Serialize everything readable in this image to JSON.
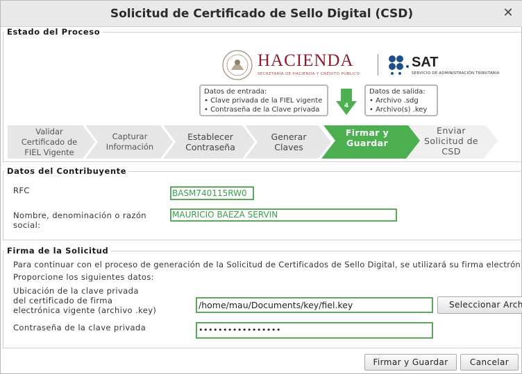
{
  "window": {
    "title": "Solicitud de Certificado de Sello Digital (CSD)"
  },
  "estado": {
    "legend": "Estado del Proceso",
    "logos": {
      "hacienda": "HACIENDA",
      "hacienda_sub": "SECRETARÍA DE HACIENDA Y CRÉDITO PÚBLICO",
      "sat": "SAT",
      "sat_sub": "SERVICIO DE ADMINISTRACIÓN TRIBUTARIA"
    },
    "entrada": {
      "title": "Datos de entrada:",
      "items": [
        "• Clave privada de la FIEL vigente",
        "• Contraseña de la Clave privada"
      ]
    },
    "salida": {
      "title": "Datos de salida:",
      "items": [
        "• Archivo .sdg",
        "• Archivo(s) .key"
      ]
    },
    "current_step_number": "4",
    "steps": [
      {
        "label": "Validar Certificado de FIEL Vigente"
      },
      {
        "label": "Capturar Información"
      },
      {
        "label": "Establecer Contraseña"
      },
      {
        "label": "Generar Claves"
      },
      {
        "label": "Firmar y Guardar"
      },
      {
        "label": "Enviar Solicitud de CSD"
      }
    ]
  },
  "contribuyente": {
    "legend": "Datos del Contribuyente",
    "rfc_label": "RFC",
    "rfc_value": "BASM740115RW0",
    "nombre_label_1": "Nombre, denominación o razón",
    "nombre_label_2": "social:",
    "nombre_value": "MAURICIO BAEZA SERVIN"
  },
  "firma": {
    "legend": "Firma de la Solicitud",
    "intro": "Para continuar con el proceso de generación de la Solicitud de Certificados de Sello Digital, se utilizará su firma electrónica vige",
    "proporcione": "Proporcione los siguientes datos:",
    "ubicacion_label": [
      "Ubicación de la clave privada",
      "del certificado de firma",
      "electrónica vigente (archivo .key)"
    ],
    "ubicacion_value": "/home/mau/Documents/key/fiel.key",
    "seleccionar_label": "Seleccionar Archivo",
    "contrasena_label": "Contraseña de la clave privada",
    "contrasena_value": "•••••••••••••••••"
  },
  "footer": {
    "firmar_label": "Firmar y Guardar",
    "cancelar_label": "Cancelar"
  },
  "colors": {
    "active_step": "#4caf50",
    "inactive_step": "#e8e8e8",
    "field_border": "#5aa85a",
    "hacienda_red": "#8c1d2a",
    "sat_blue": "#1f4f86"
  }
}
